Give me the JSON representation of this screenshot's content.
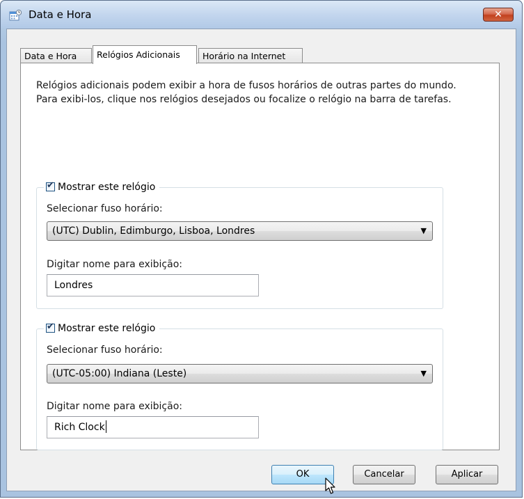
{
  "window": {
    "title": "Data e Hora",
    "close_label": "✕"
  },
  "tabs": [
    {
      "label": "Data e Hora",
      "active": false
    },
    {
      "label": "Relógios Adicionais",
      "active": true
    },
    {
      "label": "Horário na Internet",
      "active": false
    }
  ],
  "description": "Relógios adicionais podem exibir a hora de fusos horários de outras partes do mundo. Para exibi-los, clique nos relógios desejados ou focalize o relógio na barra de tarefas.",
  "clocks": [
    {
      "show_label": "Mostrar este relógio",
      "checked": true,
      "timezone_label": "Selecionar fuso horário:",
      "timezone_value": "(UTC) Dublin, Edimburgo, Lisboa, Londres",
      "name_label": "Digitar nome para exibição:",
      "name_value": "Londres"
    },
    {
      "show_label": "Mostrar este relógio",
      "checked": true,
      "timezone_label": "Selecionar fuso horário:",
      "timezone_value": "(UTC-05:00) Indiana (Leste)",
      "name_label": "Digitar nome para exibição:",
      "name_value": "Rich Clock"
    }
  ],
  "buttons": {
    "ok": "OK",
    "cancel": "Cancelar",
    "apply": "Aplicar"
  },
  "icons": {
    "window": "calendar-clock-icon",
    "dropdown": "dropdown-arrow-icon",
    "check": "checkmark-icon",
    "cursor": "mouse-pointer-icon"
  },
  "colors": {
    "titlebar": "#c3d6ee",
    "close_button": "#c2401e",
    "default_button_border": "#3c7fb1"
  }
}
